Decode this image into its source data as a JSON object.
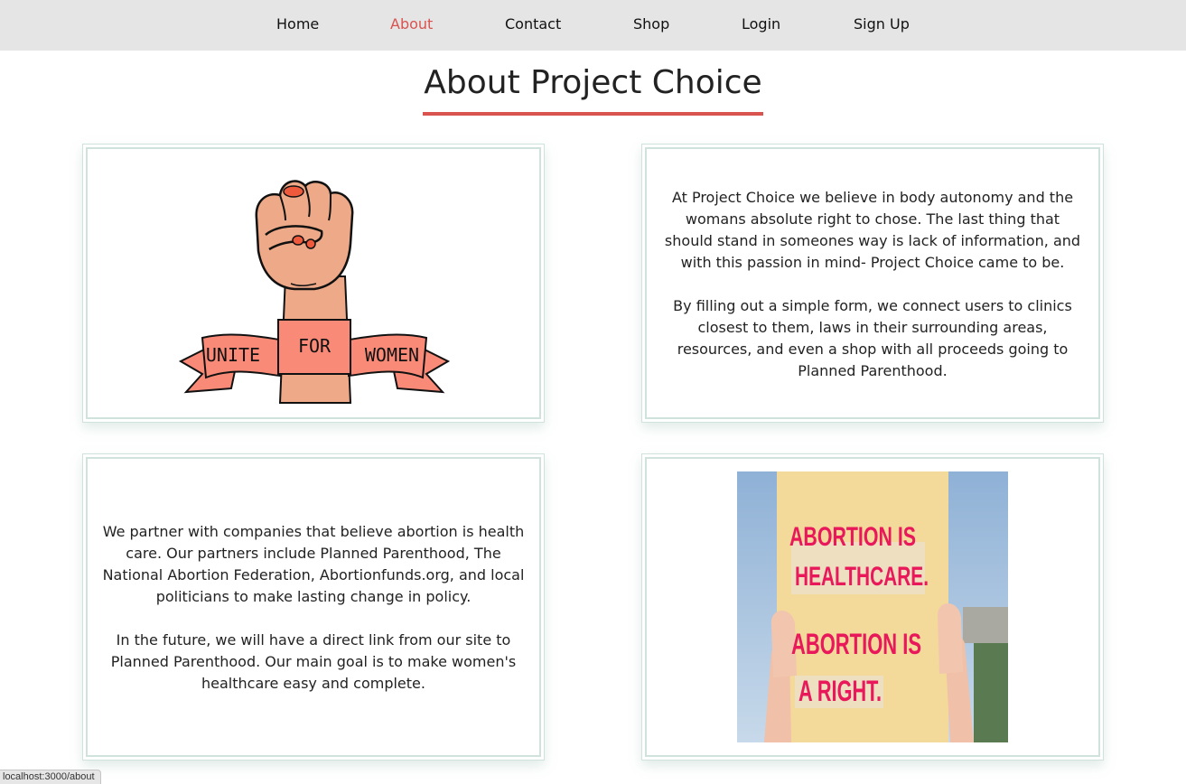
{
  "nav": {
    "items": [
      {
        "label": "Home"
      },
      {
        "label": "About"
      },
      {
        "label": "Contact"
      },
      {
        "label": "Shop"
      },
      {
        "label": "Login"
      },
      {
        "label": "Sign Up"
      }
    ],
    "active": "About",
    "active_color": "#d9534f"
  },
  "page": {
    "title": "About Project Choice",
    "accent_color": "#d9534f"
  },
  "cards": {
    "fist_image": {
      "alt": "Illustration of raised fist with banner",
      "banner_left": "UNITE",
      "banner_center": "FOR",
      "banner_right": "WOMEN"
    },
    "mission": {
      "paragraph1": "At Project Choice we believe in body autonomy and the womans absolute right to chose. The last thing that should stand in someones way is lack of information, and with this passion in mind- Project Choice came to be.",
      "paragraph2": "By filling out a simple form, we connect users to clinics closest to them, laws in their surrounding areas, resources, and even a shop with all proceeds going to Planned Parenthood."
    },
    "partners": {
      "paragraph1": "We partner with companies that believe abortion is health care. Our partners include Planned Parenthood, The National Abortion Federation, Abortionfunds.org, and local politicians to make lasting change in policy.",
      "paragraph2": "In the future, we will have a direct link from our site to Planned Parenthood. Our main goal is to make women's healthcare easy and complete."
    },
    "sign_image": {
      "alt": "Protest sign held up by hands",
      "line1": "ABORTION IS",
      "line2": "HEALTHCARE.",
      "line3": "ABORTION IS",
      "line4": "A RIGHT."
    }
  },
  "status_bar": {
    "url": "localhost:3000/about"
  }
}
